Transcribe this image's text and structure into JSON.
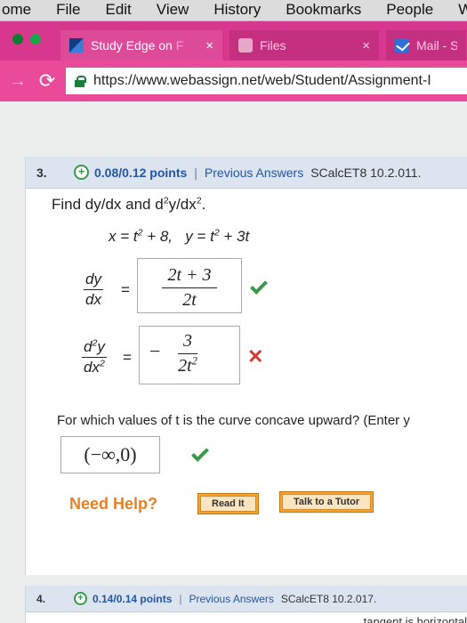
{
  "menubar": [
    "ome",
    "File",
    "Edit",
    "View",
    "History",
    "Bookmarks",
    "People",
    "Windo"
  ],
  "tabs": [
    {
      "title": "Study Edge on",
      "title_fade": "F",
      "close": "×",
      "icon": "study-edge-favicon"
    },
    {
      "title": "Files",
      "close": "×",
      "icon": "files-favicon"
    },
    {
      "title": "Mail - Sta",
      "icon": "mail-favicon"
    }
  ],
  "address": {
    "url": "https://www.webassign.net/web/Student/Assignment-I"
  },
  "colors": {
    "tab_strip": "#d7388e",
    "address_bar": "#e94b9a",
    "link_blue": "#2356a7",
    "correct_green": "#3a9a4a",
    "wrong_red": "#d43a34",
    "help_orange": "#e48228"
  },
  "question3": {
    "number": "3.",
    "points": "0.08/0.12 points",
    "separator": "|",
    "previous_answers": "Previous Answers",
    "reference": "SCalcET8 10.2.011.",
    "prompt_prefix": "Find dy/dx and d",
    "prompt_sup1": "2",
    "prompt_mid": "y/dx",
    "prompt_sup2": "2",
    "prompt_suffix": ".",
    "given_x": "x = t",
    "given_x_sup": "2",
    "given_x_rest": " + 8,",
    "given_y": "y = t",
    "given_y_sup": "2",
    "given_y_rest": " + 3t",
    "first_deriv": {
      "num": "dy",
      "den": "dx",
      "eq": "=",
      "ans_num": "2t + 3",
      "ans_den": "2t",
      "status": "correct"
    },
    "second_deriv": {
      "num_d": "d",
      "num_sup": "2",
      "num_y": "y",
      "den_dx": "dx",
      "den_sup": "2",
      "eq": "=",
      "minus": "−",
      "ans_num": "3",
      "ans_den_base": "2t",
      "ans_den_sup": "2",
      "status": "incorrect",
      "mark": "✕"
    },
    "concave_question": "For which values of t is the curve concave upward? (Enter y",
    "interval_answer": "(−∞,0)",
    "need_help": "Need Help?",
    "read_it": "Read It",
    "talk_tutor": "Talk to a Tutor"
  },
  "question4": {
    "number": "4.",
    "points": "0.14/0.14 points",
    "separator": "|",
    "previous_answers": "Previous Answers",
    "reference": "SCalcET8 10.2.017.",
    "next_text": "tangent is horizontal"
  }
}
